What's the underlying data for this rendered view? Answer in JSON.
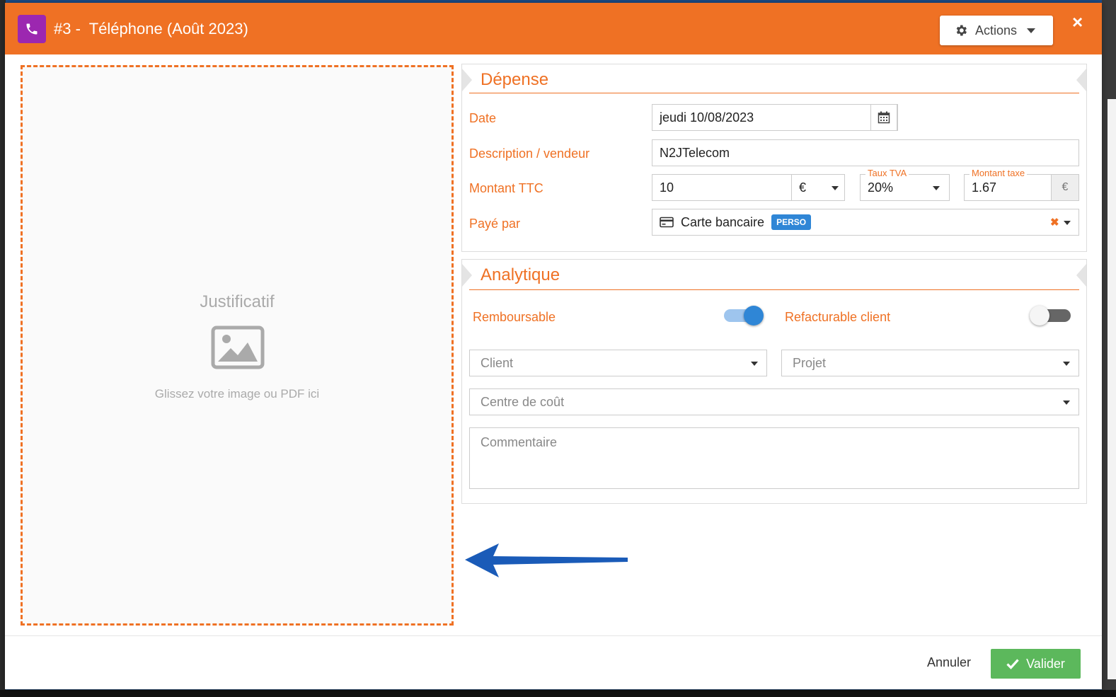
{
  "modal": {
    "title": "#3 -  Téléphone (Août 2023)",
    "actions_label": "Actions",
    "close_label": "×"
  },
  "dropzone": {
    "title": "Justificatif",
    "hint": "Glissez votre image ou PDF ici"
  },
  "depense": {
    "section_title": "Dépense",
    "date_label": "Date",
    "date_value": "jeudi 10/08/2023",
    "description_label": "Description / vendeur",
    "description_value": "N2JTelecom",
    "montant_label": "Montant TTC",
    "montant_value": "10",
    "currency": "€",
    "tva_label": "Taux TVA",
    "tva_value": "20%",
    "taxe_label": "Montant taxe",
    "taxe_value": "1.67",
    "taxe_currency": "€",
    "paye_label": "Payé par",
    "paye_value": "Carte bancaire",
    "paye_badge": "PERSO",
    "clear_label": "✖"
  },
  "analytique": {
    "section_title": "Analytique",
    "remboursable_label": "Remboursable",
    "remboursable_on": true,
    "refacturable_label": "Refacturable client",
    "refacturable_on": false,
    "client_placeholder": "Client",
    "projet_placeholder": "Projet",
    "centre_placeholder": "Centre de coût",
    "commentaire_placeholder": "Commentaire"
  },
  "footer": {
    "cancel_label": "Annuler",
    "ok_label": "Valider"
  },
  "colors": {
    "accent": "#ef7124",
    "phone_badge": "#9c27b0",
    "toggle_on": "#2f86d6",
    "ok_button": "#5cb85c",
    "annotation_arrow": "#1a5bb8"
  },
  "icons": {
    "phone": "phone-icon",
    "gear": "gear-icon",
    "calendar": "calendar-icon",
    "card": "credit-card-icon",
    "image": "image-icon",
    "check": "check-icon"
  }
}
